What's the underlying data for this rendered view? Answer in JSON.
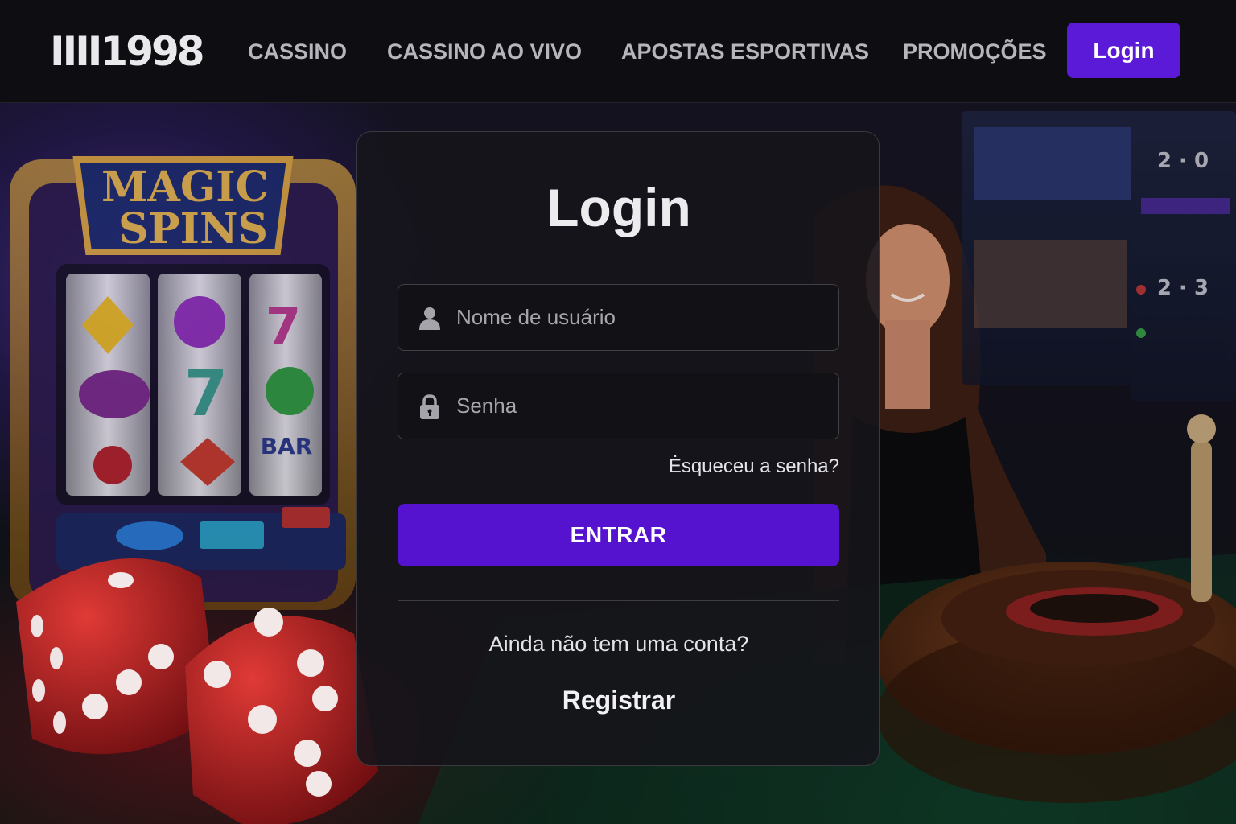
{
  "brand": {
    "logo_text": "IIII1998"
  },
  "nav": {
    "links": [
      "CASSINO",
      "CASSINO AO VIVO",
      "APOSTAS ESPORTIVAS",
      "PROMOÇÕES"
    ],
    "login_button": "Login"
  },
  "background": {
    "slot_machine_sign": [
      "MAGIC",
      "SPINS"
    ],
    "slot_reel_text": "BAR"
  },
  "login_form": {
    "title": "Login",
    "username_placeholder": "Nome de usuário",
    "password_placeholder": "Senha",
    "forgot_password": "Ėsqueceu a senha?",
    "submit_label": "ENTRAR",
    "no_account_text": "Ainda não tem uma conta?",
    "register_label": "Registrar"
  },
  "colors": {
    "accent": "#5513cf",
    "nav_login_bg": "#5b19d8",
    "card_bg": "#16151a"
  }
}
